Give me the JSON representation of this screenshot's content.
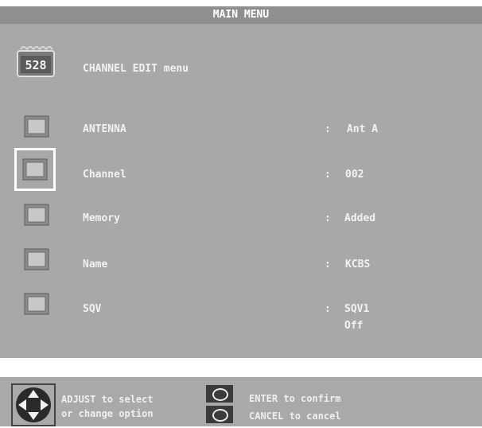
{
  "header": {
    "title": "MAIN MENU"
  },
  "menu": {
    "icon_label": "5 2 8",
    "title": "CHANNEL EDIT menu",
    "selected_index": 1,
    "rows": [
      {
        "label": "ANTENNA",
        "colon": ":",
        "value": "Ant A"
      },
      {
        "label": "Channel",
        "colon": ":",
        "value": "002"
      },
      {
        "label": "Memory",
        "colon": ":",
        "value": "Added"
      },
      {
        "label": "Name",
        "colon": ":",
        "value": "KCBS"
      },
      {
        "label": "SQV",
        "colon": ":",
        "value": "SQV1",
        "value2": "Off"
      }
    ]
  },
  "footer": {
    "adjust_line1": "ADJUST to select",
    "adjust_line2": "or change option",
    "enter_text": "ENTER to confirm",
    "cancel_text": "CANCEL to cancel"
  }
}
